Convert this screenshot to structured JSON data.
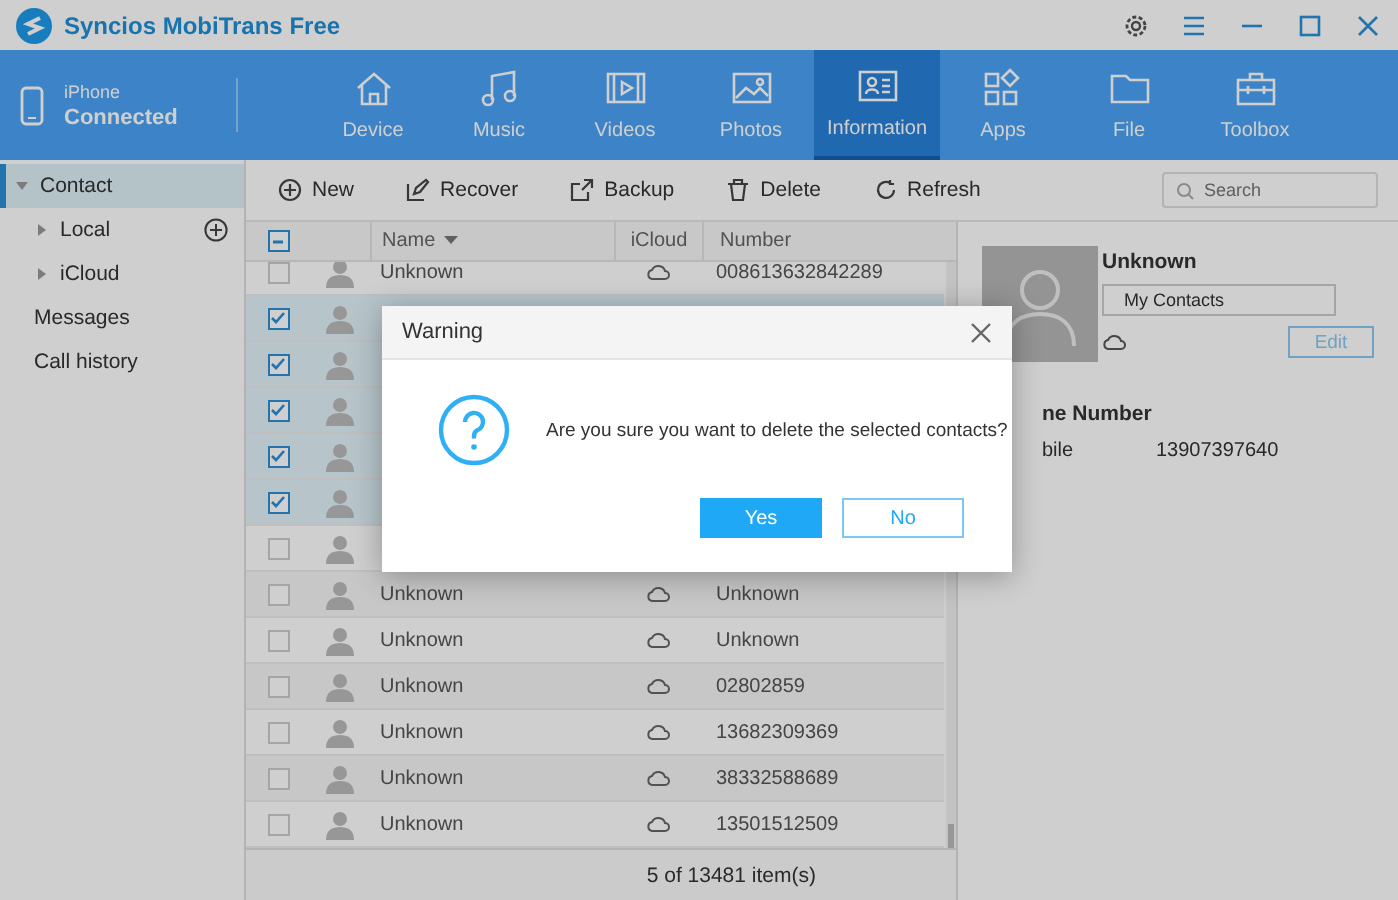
{
  "window": {
    "title": "Syncios MobiTrans Free"
  },
  "device": {
    "name": "iPhone",
    "status": "Connected"
  },
  "nav": [
    {
      "label": "Device",
      "selected": false
    },
    {
      "label": "Music",
      "selected": false
    },
    {
      "label": "Videos",
      "selected": false
    },
    {
      "label": "Photos",
      "selected": false
    },
    {
      "label": "Information",
      "selected": true
    },
    {
      "label": "Apps",
      "selected": false
    },
    {
      "label": "File",
      "selected": false
    },
    {
      "label": "Toolbox",
      "selected": false
    }
  ],
  "sidebar": {
    "items": [
      {
        "label": "Contact",
        "selected": true,
        "expanded": true,
        "children": [
          {
            "label": "Local",
            "selected": false,
            "expanded": false,
            "addable": true
          },
          {
            "label": "iCloud",
            "selected": false,
            "expanded": false
          }
        ]
      },
      {
        "label": "Messages",
        "selected": false
      },
      {
        "label": "Call history",
        "selected": false
      }
    ]
  },
  "toolbar": {
    "buttons": [
      "New",
      "Recover",
      "Backup",
      "Delete",
      "Refresh"
    ],
    "search": {
      "placeholder": "Search"
    }
  },
  "table": {
    "header_checkbox": {
      "partial": true
    },
    "columns": [
      {
        "label": "Name",
        "sorted": true
      },
      {
        "label": "iCloud",
        "sorted": false
      },
      {
        "label": "Number",
        "sorted": false
      }
    ],
    "rows": [
      {
        "checked": false,
        "name": "Unknown",
        "icloud": true,
        "number": "008613632842289"
      },
      {
        "checked": true
      },
      {
        "checked": true
      },
      {
        "checked": true
      },
      {
        "checked": true
      },
      {
        "checked": true
      },
      {
        "checked": false
      },
      {
        "checked": false,
        "name": "Unknown",
        "icloud": true,
        "number": "Unknown"
      },
      {
        "checked": false,
        "name": "Unknown",
        "icloud": true,
        "number": "Unknown"
      },
      {
        "checked": false,
        "name": "Unknown",
        "icloud": true,
        "number": "02802859"
      },
      {
        "checked": false,
        "name": "Unknown",
        "icloud": true,
        "number": "13682309369"
      },
      {
        "checked": false,
        "name": "Unknown",
        "icloud": true,
        "number": "38332588689"
      },
      {
        "checked": false,
        "name": "Unknown",
        "icloud": true,
        "number": "13501512509"
      }
    ]
  },
  "status_bar": "5 of 13481 item(s)",
  "detail": {
    "name": "Unknown",
    "group": "My Contacts",
    "icloud": true,
    "edit": "Edit",
    "section": "ne Number",
    "phone_label": "bile",
    "phone": "13907397640"
  },
  "dialog": {
    "title": "Warning",
    "message": "Are you sure you want to delete the selected contacts?",
    "buttons": [
      {
        "label": "Yes",
        "kind": "primary"
      },
      {
        "label": "No",
        "kind": "secondary"
      }
    ]
  }
}
